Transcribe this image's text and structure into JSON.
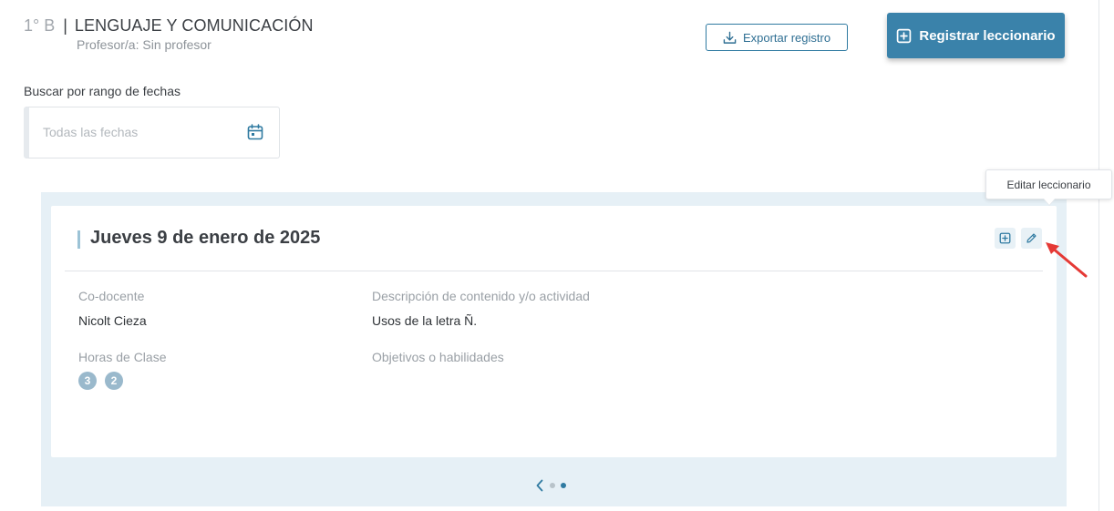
{
  "header": {
    "grade": "1° B",
    "separator": "|",
    "subject": "LENGUAJE Y COMUNICACIÓN",
    "teacher": "Profesor/a: Sin profesor"
  },
  "actions": {
    "export_label": "Exportar registro",
    "register_label": "Registrar leccionario"
  },
  "search": {
    "label": "Buscar por rango de fechas",
    "placeholder": "Todas las fechas"
  },
  "tooltip": {
    "text": "Editar leccionario"
  },
  "card": {
    "date_title": "Jueves 9 de enero de 2025",
    "co_teacher_label": "Co-docente",
    "co_teacher_value": "Nicolt Cieza",
    "description_label": "Descripción de contenido y/o actividad",
    "description_value": "Usos de la letra Ñ.",
    "hours_label": "Horas de Clase",
    "hours": [
      "3",
      "2"
    ],
    "objectives_label": "Objetivos o habilidades"
  },
  "pager": {
    "current_index": 2,
    "total": 2
  },
  "colors": {
    "primary": "#3a82aa",
    "accent_light": "#e6f0f6",
    "badge": "#9ab9cc",
    "annotation": "#e53935"
  },
  "icons": {
    "export": "download-icon",
    "register": "plus-square-icon",
    "calendar": "calendar-icon",
    "add": "plus-square-icon",
    "edit": "pencil-icon",
    "prev": "chevron-left-icon"
  }
}
